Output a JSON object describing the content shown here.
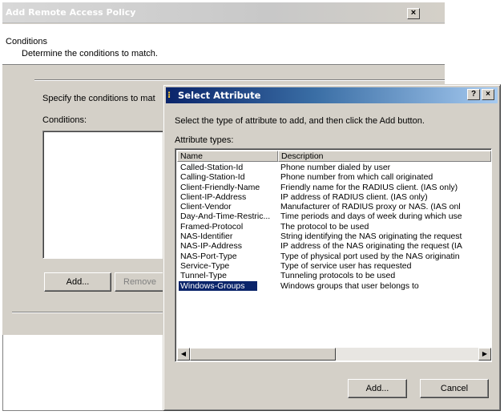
{
  "wizard": {
    "title": "Add Remote Access Policy",
    "close_label": "×",
    "header_title": "Conditions",
    "header_subtitle": "Determine the conditions to match.",
    "specify_text": "Specify the conditions to mat",
    "conditions_label": "Conditions:",
    "add_label": "Add...",
    "remove_label": "Remove"
  },
  "dialog": {
    "title": "Select Attribute",
    "help_label": "?",
    "close_label": "×",
    "instruction": "Select the type of attribute to add, and then click the Add button.",
    "attribute_types_label": "Attribute types:",
    "columns": [
      "Name",
      "Description"
    ],
    "rows": [
      {
        "name": "Called-Station-Id",
        "description": "Phone number dialed by user"
      },
      {
        "name": "Calling-Station-Id",
        "description": "Phone number from which call originated"
      },
      {
        "name": "Client-Friendly-Name",
        "description": "Friendly name for the RADIUS client. (IAS only)"
      },
      {
        "name": "Client-IP-Address",
        "description": "IP address of RADIUS client. (IAS only)"
      },
      {
        "name": "Client-Vendor",
        "description": "Manufacturer of RADIUS proxy or NAS. (IAS onl"
      },
      {
        "name": "Day-And-Time-Restric...",
        "description": "Time periods and days of week during which use"
      },
      {
        "name": "Framed-Protocol",
        "description": "The protocol to be used"
      },
      {
        "name": "NAS-Identifier",
        "description": "String identifying the NAS originating the request"
      },
      {
        "name": "NAS-IP-Address",
        "description": "IP address of the NAS originating the request (IA"
      },
      {
        "name": "NAS-Port-Type",
        "description": "Type of physical port used by the NAS originatin"
      },
      {
        "name": "Service-Type",
        "description": "Type of service user has requested"
      },
      {
        "name": "Tunnel-Type",
        "description": "Tunneling protocols to be used"
      },
      {
        "name": "Windows-Groups",
        "description": "Windows groups that user belongs to"
      }
    ],
    "selected_index": 12,
    "scroll_left": "◀",
    "scroll_right": "▶",
    "add_label": "Add...",
    "cancel_label": "Cancel"
  },
  "colors": {
    "title_active": "#0a246a",
    "title_inactive": "#c8c8c8",
    "face": "#d4d0c8",
    "selection": "#0a246a"
  }
}
